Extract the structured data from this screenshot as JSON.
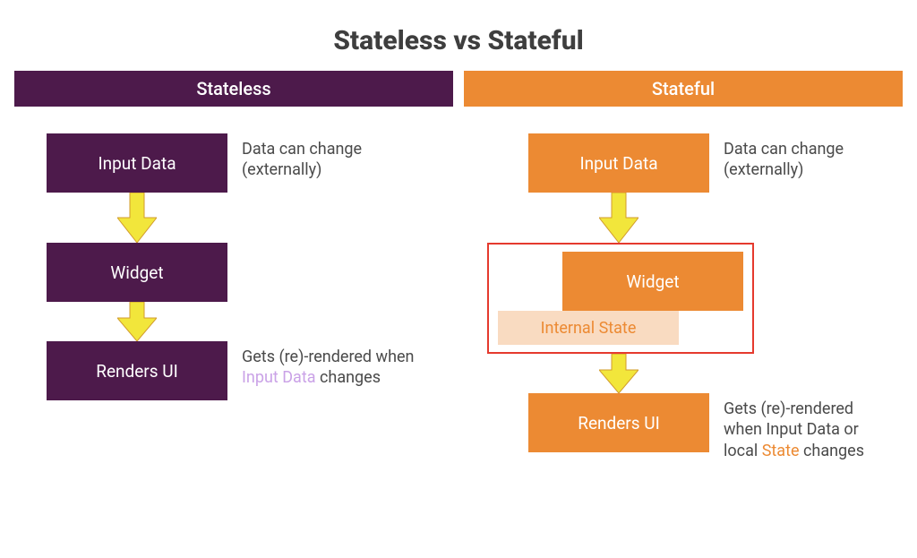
{
  "title": "Stateless vs Stateful",
  "stateless": {
    "header": "Stateless",
    "input_box": "Input Data",
    "input_note": "Data can change (externally)",
    "widget_box": "Widget",
    "render_box": "Renders UI",
    "render_note_prefix": "Gets (re)-rendered when ",
    "render_note_hl": "Input Data",
    "render_note_suffix": " changes"
  },
  "stateful": {
    "header": "Stateful",
    "input_box": "Input Data",
    "input_note": "Data can change (externally)",
    "widget_box": "Widget",
    "internal_state": "Internal State",
    "render_box": "Renders UI",
    "render_note_prefix": "Gets (re)-rendered when Input Data or local ",
    "render_note_hl": "State",
    "render_note_suffix": " changes"
  },
  "colors": {
    "purple": "#4d1a4b",
    "orange": "#ec8a33",
    "arrow_fill": "#f2e63b",
    "arrow_stroke": "#d19b2e",
    "highlight_frame": "#e53a2e"
  }
}
